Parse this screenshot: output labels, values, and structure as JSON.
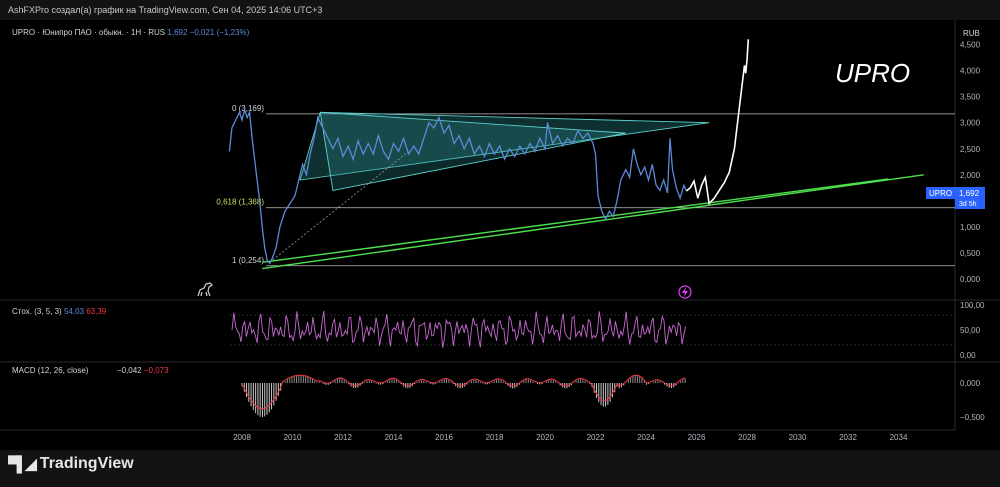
{
  "header": {
    "caption": "AshFXPro создал(а) график на TradingView.com, Сен 04, 2025 14:06 UTC+3"
  },
  "main": {
    "symbol_line": "UPRO · Юнипро ПАО · обыкн. · 1H · RUS",
    "symbol_price": "1,692",
    "symbol_change": "−0,021 (−1,23%)",
    "big_title": "UPRO",
    "currency": "RUB",
    "price_tag_symbol": "UPRO",
    "price_tag_value": "1,692",
    "price_tag_countdown": "3d 5h"
  },
  "stoch": {
    "label": "Стох. (3, 5, 3)",
    "k": "54,03",
    "d": "63,39"
  },
  "macd": {
    "label": "MACD (12, 26, close)",
    "v1": "−0,042",
    "v2": "−0,073"
  },
  "footer": {
    "logo_text": "TradingView"
  },
  "colors": {
    "price": "#5b8bd6",
    "triangle_fill": "#2a8a8a",
    "trend": "#4ee04e",
    "stoch": "#c66ad0",
    "macd_pos": "#b8b8b8",
    "macd_neg": "#f23645"
  },
  "chart_data": {
    "type": "line",
    "x_ticks": [
      "2008",
      "2010",
      "2012",
      "2014",
      "2016",
      "2018",
      "2020",
      "2022",
      "2024",
      "2026",
      "2028",
      "2030",
      "2032",
      "2034"
    ],
    "y_ticks": [
      "4,500",
      "4,000",
      "3,500",
      "3,000",
      "2,500",
      "2,000",
      "1,500",
      "1,000",
      "0,500",
      "0,000"
    ],
    "ylim": [
      0,
      4.7
    ],
    "xlim": [
      2007.2,
      2035.2
    ],
    "fib_levels": [
      {
        "label": "0 (3,169)",
        "value": 3.169
      },
      {
        "label": "0,618 (1,368)",
        "value": 1.368
      },
      {
        "label": "1 (0,254)",
        "value": 0.254
      }
    ],
    "price_series": [
      [
        2007.5,
        2.45
      ],
      [
        2007.6,
        2.9
      ],
      [
        2007.75,
        3.05
      ],
      [
        2007.9,
        3.2
      ],
      [
        2008.0,
        3.05
      ],
      [
        2008.1,
        3.25
      ],
      [
        2008.2,
        3.1
      ],
      [
        2008.3,
        3.2
      ],
      [
        2008.4,
        2.7
      ],
      [
        2008.5,
        2.3
      ],
      [
        2008.6,
        1.9
      ],
      [
        2008.7,
        1.5
      ],
      [
        2008.8,
        1.0
      ],
      [
        2008.9,
        0.6
      ],
      [
        2009.0,
        0.35
      ],
      [
        2009.1,
        0.3
      ],
      [
        2009.2,
        0.4
      ],
      [
        2009.35,
        0.6
      ],
      [
        2009.5,
        1.0
      ],
      [
        2009.7,
        1.3
      ],
      [
        2009.9,
        1.45
      ],
      [
        2010.1,
        1.6
      ],
      [
        2010.25,
        1.9
      ],
      [
        2010.4,
        2.2
      ],
      [
        2010.55,
        2.0
      ],
      [
        2010.7,
        2.4
      ],
      [
        2010.85,
        2.7
      ],
      [
        2011.0,
        3.1
      ],
      [
        2011.2,
        2.9
      ],
      [
        2011.4,
        2.7
      ],
      [
        2011.6,
        2.5
      ],
      [
        2011.8,
        2.7
      ],
      [
        2012.0,
        2.35
      ],
      [
        2012.2,
        2.55
      ],
      [
        2012.4,
        2.3
      ],
      [
        2012.6,
        2.65
      ],
      [
        2012.8,
        2.4
      ],
      [
        2013.0,
        2.6
      ],
      [
        2013.2,
        2.4
      ],
      [
        2013.4,
        2.75
      ],
      [
        2013.6,
        2.45
      ],
      [
        2013.8,
        2.3
      ],
      [
        2014.0,
        2.6
      ],
      [
        2014.2,
        2.45
      ],
      [
        2014.4,
        2.7
      ],
      [
        2014.6,
        2.4
      ],
      [
        2014.8,
        2.55
      ],
      [
        2015.0,
        2.4
      ],
      [
        2015.2,
        2.7
      ],
      [
        2015.4,
        3.0
      ],
      [
        2015.6,
        2.9
      ],
      [
        2015.8,
        3.1
      ],
      [
        2016.0,
        2.8
      ],
      [
        2016.2,
        2.95
      ],
      [
        2016.4,
        2.6
      ],
      [
        2016.6,
        2.75
      ],
      [
        2016.8,
        2.5
      ],
      [
        2017.0,
        2.7
      ],
      [
        2017.2,
        2.4
      ],
      [
        2017.4,
        2.55
      ],
      [
        2017.6,
        2.35
      ],
      [
        2017.8,
        2.6
      ],
      [
        2018.0,
        2.4
      ],
      [
        2018.2,
        2.55
      ],
      [
        2018.4,
        2.3
      ],
      [
        2018.6,
        2.5
      ],
      [
        2018.8,
        2.35
      ],
      [
        2019.0,
        2.55
      ],
      [
        2019.2,
        2.4
      ],
      [
        2019.4,
        2.6
      ],
      [
        2019.6,
        2.45
      ],
      [
        2019.8,
        2.7
      ],
      [
        2020.0,
        2.5
      ],
      [
        2020.1,
        3.0
      ],
      [
        2020.3,
        2.6
      ],
      [
        2020.5,
        2.75
      ],
      [
        2020.7,
        2.55
      ],
      [
        2020.9,
        2.7
      ],
      [
        2021.1,
        2.6
      ],
      [
        2021.3,
        2.85
      ],
      [
        2021.5,
        2.7
      ],
      [
        2021.7,
        2.8
      ],
      [
        2021.9,
        2.6
      ],
      [
        2022.0,
        2.4
      ],
      [
        2022.1,
        1.6
      ],
      [
        2022.25,
        1.3
      ],
      [
        2022.4,
        1.15
      ],
      [
        2022.55,
        1.3
      ],
      [
        2022.7,
        1.2
      ],
      [
        2022.85,
        1.5
      ],
      [
        2023.0,
        1.9
      ],
      [
        2023.2,
        2.1
      ],
      [
        2023.35,
        1.95
      ],
      [
        2023.5,
        2.5
      ],
      [
        2023.65,
        2.2
      ],
      [
        2023.8,
        2.0
      ],
      [
        2023.95,
        2.15
      ],
      [
        2024.1,
        1.9
      ],
      [
        2024.25,
        2.2
      ],
      [
        2024.4,
        1.8
      ],
      [
        2024.55,
        1.7
      ],
      [
        2024.7,
        1.9
      ],
      [
        2024.85,
        1.65
      ],
      [
        2024.95,
        2.7
      ],
      [
        2025.05,
        2.1
      ],
      [
        2025.2,
        1.75
      ],
      [
        2025.35,
        1.55
      ],
      [
        2025.5,
        1.8
      ],
      [
        2025.6,
        1.69
      ]
    ],
    "projection": [
      [
        2025.6,
        1.69
      ],
      [
        2025.75,
        1.75
      ],
      [
        2025.9,
        1.88
      ],
      [
        2026.05,
        1.55
      ],
      [
        2026.2,
        1.8
      ],
      [
        2026.35,
        1.95
      ],
      [
        2026.5,
        1.45
      ],
      [
        2026.7,
        1.55
      ],
      [
        2026.9,
        1.7
      ],
      [
        2027.1,
        1.85
      ],
      [
        2027.3,
        2.05
      ],
      [
        2027.5,
        2.5
      ],
      [
        2027.7,
        3.3
      ],
      [
        2027.85,
        3.9
      ],
      [
        2027.9,
        4.1
      ],
      [
        2027.95,
        3.95
      ],
      [
        2028.0,
        4.2
      ],
      [
        2028.05,
        4.6
      ]
    ],
    "trend_lines": [
      {
        "from": [
          2008.8,
          0.2
        ],
        "to": [
          2035.0,
          2.0
        ]
      },
      {
        "from": [
          2008.8,
          0.32
        ],
        "to": [
          2033.6,
          1.92
        ]
      }
    ],
    "triangle": {
      "outer": [
        [
          2011.1,
          3.2
        ],
        [
          2026.5,
          3.0
        ],
        [
          2010.3,
          1.9
        ]
      ],
      "inner": [
        [
          2011.1,
          3.2
        ],
        [
          2023.2,
          2.8
        ],
        [
          2011.6,
          1.7
        ]
      ]
    }
  }
}
